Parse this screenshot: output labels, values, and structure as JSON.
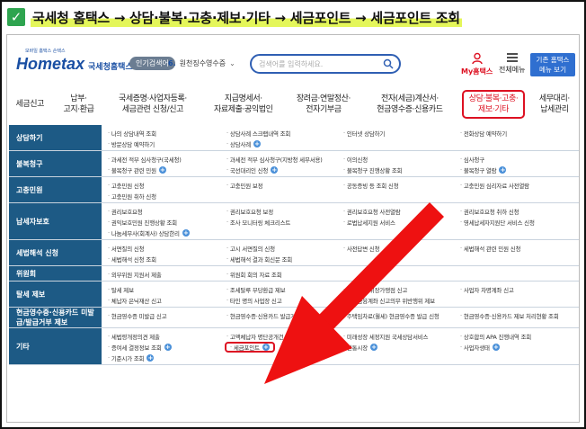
{
  "title": "국세청 홈택스 → 상담·불복·고충·제보·기타 → 세금포인트 → 세금포인트 조회",
  "header": {
    "logo_main": "Hometax",
    "logo_sub": "국세청홈택스",
    "logo_tag": "모바일 홈택스 손택스",
    "popular_badge": "인기검색어",
    "popular_num": "6.",
    "popular_term": "원천징수영수증",
    "search_placeholder": "검색어를 입력하세요.",
    "myhome_label": "My홈택스",
    "menu_label": "전체메뉴",
    "legacy_line1": "기존 홈택스",
    "legacy_line2": "메뉴 보기"
  },
  "nav": [
    {
      "l1": "세금신고",
      "l2": ""
    },
    {
      "l1": "납부·",
      "l2": "고지·환급"
    },
    {
      "l1": "국세증명·사업자등록·",
      "l2": "세금관련 신청/신고"
    },
    {
      "l1": "지급명세서·",
      "l2": "자료제출·공익법인"
    },
    {
      "l1": "장려금·연말정산·",
      "l2": "전자기부금"
    },
    {
      "l1": "전자(세금)계산서·",
      "l2": "현금영수증·신용카드"
    },
    {
      "l1": "상담·불복·고충·",
      "l2": "제보·기타"
    },
    {
      "l1": "세무대리·",
      "l2": "납세관리"
    }
  ],
  "rows": [
    {
      "head": "상담하기",
      "cells": [
        {
          "t": "나의 상담내역 조회"
        },
        {
          "t": "상담사례 스크랩내역 조회"
        },
        {
          "t": "인터넷 상담하기"
        },
        {
          "t": "전화상담 예약하기"
        },
        {
          "t": "방문상담 예약하기"
        },
        {
          "t": "상담사례",
          "plus": true
        },
        {
          "t": ""
        },
        {
          "t": ""
        }
      ]
    },
    {
      "head": "불복청구",
      "cells": [
        {
          "t": "과세전 적부 심사청구(국세청)"
        },
        {
          "t": "과세전 적부 심사청구(지방청 세무서용)"
        },
        {
          "t": "이의신청"
        },
        {
          "t": "심사청구"
        },
        {
          "t": "불복청구 관련 민원",
          "plus": true
        },
        {
          "t": "국선대리인 신청",
          "plus": true
        },
        {
          "t": "불복청구 진행상황 조회"
        },
        {
          "t": "불복청구 열람",
          "plus": true
        }
      ]
    },
    {
      "head": "고충민원",
      "cells": [
        {
          "t": "고충민원 신청"
        },
        {
          "t": "고충민원 보정"
        },
        {
          "t": "공동증빙 등 조회 신청"
        },
        {
          "t": "고충민원 심리자료 사전열람"
        },
        {
          "t": "고충민원 취하 신청"
        },
        {
          "t": ""
        },
        {
          "t": ""
        },
        {
          "t": ""
        }
      ]
    },
    {
      "head": "납세자보호",
      "cells": [
        {
          "t": "권리보호요청"
        },
        {
          "t": "권리보호요청 보정"
        },
        {
          "t": "권리보호요청 사전열람"
        },
        {
          "t": "권리보호요청 취하 신청"
        },
        {
          "t": "권익보호민원 진행상황 조회"
        },
        {
          "t": "조사 모니터링 체크리스트"
        },
        {
          "t": "로법납세지원 서비스"
        },
        {
          "t": "영세납세자지원단 서비스 신청"
        },
        {
          "t": "나눔세무사(회계사) 상담한리",
          "plus": true
        },
        {
          "t": ""
        },
        {
          "t": ""
        },
        {
          "t": ""
        }
      ]
    },
    {
      "head": "세법해석 신청",
      "cells": [
        {
          "t": "서면질의 신청"
        },
        {
          "t": "고시 서면질의 신청"
        },
        {
          "t": "사전답변 신청"
        },
        {
          "t": "세법해석 관련 민원 신청"
        },
        {
          "t": "세법해석 신청 조회"
        },
        {
          "t": "세법해석 결과 회신문 조회"
        },
        {
          "t": ""
        },
        {
          "t": ""
        }
      ]
    },
    {
      "head": "위원회",
      "cells": [
        {
          "t": "외부위원 지원서 제출"
        },
        {
          "t": "위원회 회의 자료 조회"
        },
        {
          "t": ""
        },
        {
          "t": ""
        }
      ]
    },
    {
      "head": "탈세 제보",
      "cells": [
        {
          "t": "탈세 제보"
        },
        {
          "t": "조세탈루 부당환급 제보"
        },
        {
          "t": "신용카드 위장가맹점 신고"
        },
        {
          "t": "사업자 차명계좌 신고"
        },
        {
          "t": "체납자 은닉재산 신고"
        },
        {
          "t": "타인 명의 사업장 신고"
        },
        {
          "t": "해외금융계좌 신고의무 위반행위 제보"
        },
        {
          "t": ""
        }
      ]
    },
    {
      "head": "현금영수증·신용카드 미발급/발급거부 제보",
      "cells": [
        {
          "t": "현금영수증 미발급 신고"
        },
        {
          "t": "현금영수증·신용카드 발급거부 신고"
        },
        {
          "t": "주택임차료(월세) 현금영수증 발급 신청"
        },
        {
          "t": "현금영수증·신용카드 제보 처리현황 조회"
        }
      ]
    },
    {
      "head": "기타",
      "cells": [
        {
          "t": "세법령개정의견 제출"
        },
        {
          "t": "고액체납자 명단공개건"
        },
        {
          "t": "미래성장 세정지원 국세상담서비스"
        },
        {
          "t": "상호합의 APA 진행내역 조회"
        },
        {
          "t": "증여세 결정정보 조회",
          "plus": true
        },
        {
          "t": "세금포인트",
          "plus": true,
          "hl": true
        },
        {
          "t": "전통시장",
          "plus": true
        },
        {
          "t": "사업자생태",
          "plus": true
        },
        {
          "t": "기준시가 조회",
          "plus": true
        },
        {
          "t": ""
        },
        {
          "t": ""
        },
        {
          "t": ""
        }
      ]
    }
  ],
  "colors": {
    "accent": "#d12222",
    "header_bg": "#1d5a85",
    "brand": "#1a4fa3"
  }
}
